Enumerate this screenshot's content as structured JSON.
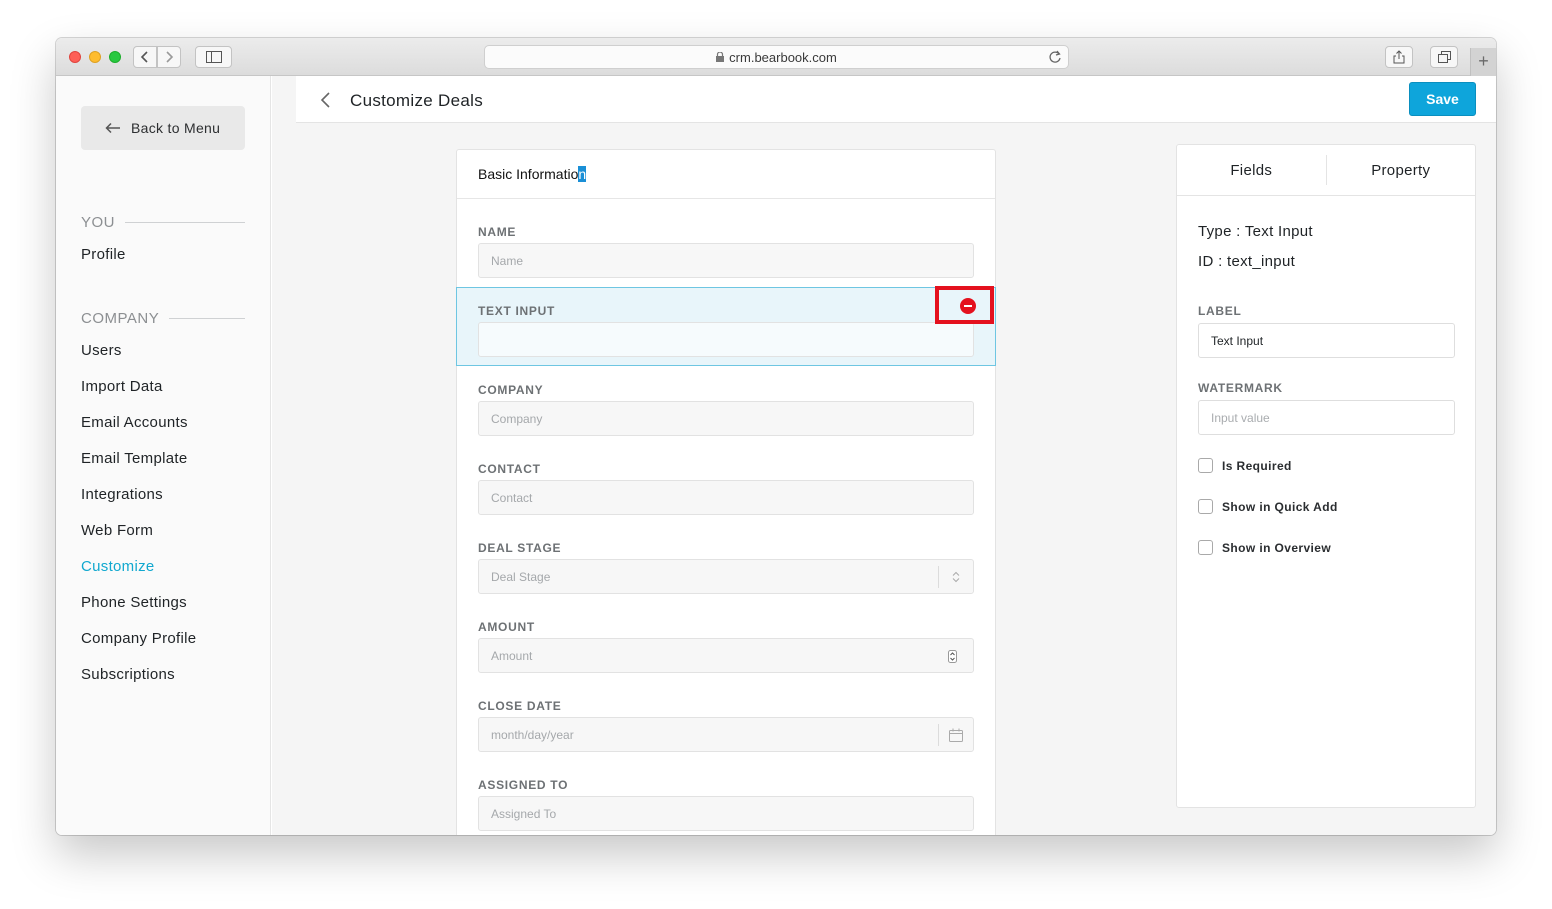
{
  "browser": {
    "url": "crm.bearbook.com"
  },
  "sidebar": {
    "back_label": "Back to Menu",
    "section_you": "YOU",
    "section_company": "COMPANY",
    "items": [
      {
        "label": "Profile"
      },
      {
        "label": "Users"
      },
      {
        "label": "Import Data"
      },
      {
        "label": "Email Accounts"
      },
      {
        "label": "Email Template"
      },
      {
        "label": "Integrations"
      },
      {
        "label": "Web Form"
      },
      {
        "label": "Customize",
        "active": true
      },
      {
        "label": "Phone Settings"
      },
      {
        "label": "Company Profile"
      },
      {
        "label": "Subscriptions"
      }
    ]
  },
  "header": {
    "title": "Customize Deals",
    "save_label": "Save"
  },
  "form": {
    "section_title_main": "Basic Informatio",
    "section_title_selected": "n",
    "fields": [
      {
        "label": "NAME",
        "placeholder": "Name"
      },
      {
        "label": "TEXT INPUT",
        "placeholder": "",
        "selected": true
      },
      {
        "label": "COMPANY",
        "placeholder": "Company"
      },
      {
        "label": "CONTACT",
        "placeholder": "Contact"
      },
      {
        "label": "DEAL STAGE",
        "placeholder": "Deal Stage",
        "icon": "select-arrows-icon"
      },
      {
        "label": "AMOUNT",
        "placeholder": "Amount",
        "icon": "number-spinner-icon"
      },
      {
        "label": "CLOSE DATE",
        "placeholder": "month/day/year",
        "icon": "calendar-icon"
      },
      {
        "label": "ASSIGNED TO",
        "placeholder": "Assigned To"
      }
    ]
  },
  "property_panel": {
    "tabs": [
      "Fields",
      "Property"
    ],
    "type_line": "Type : Text Input",
    "id_line": "ID : text_input",
    "label_heading": "LABEL",
    "label_value": "Text Input",
    "watermark_heading": "WATERMARK",
    "watermark_placeholder": "Input value",
    "checkboxes": [
      "Is Required",
      "Show in Quick Add",
      "Show in Overview"
    ]
  },
  "colors": {
    "accent": "#0ea5db",
    "active_nav": "#11a8cf",
    "highlight_border": "#e4111e"
  }
}
